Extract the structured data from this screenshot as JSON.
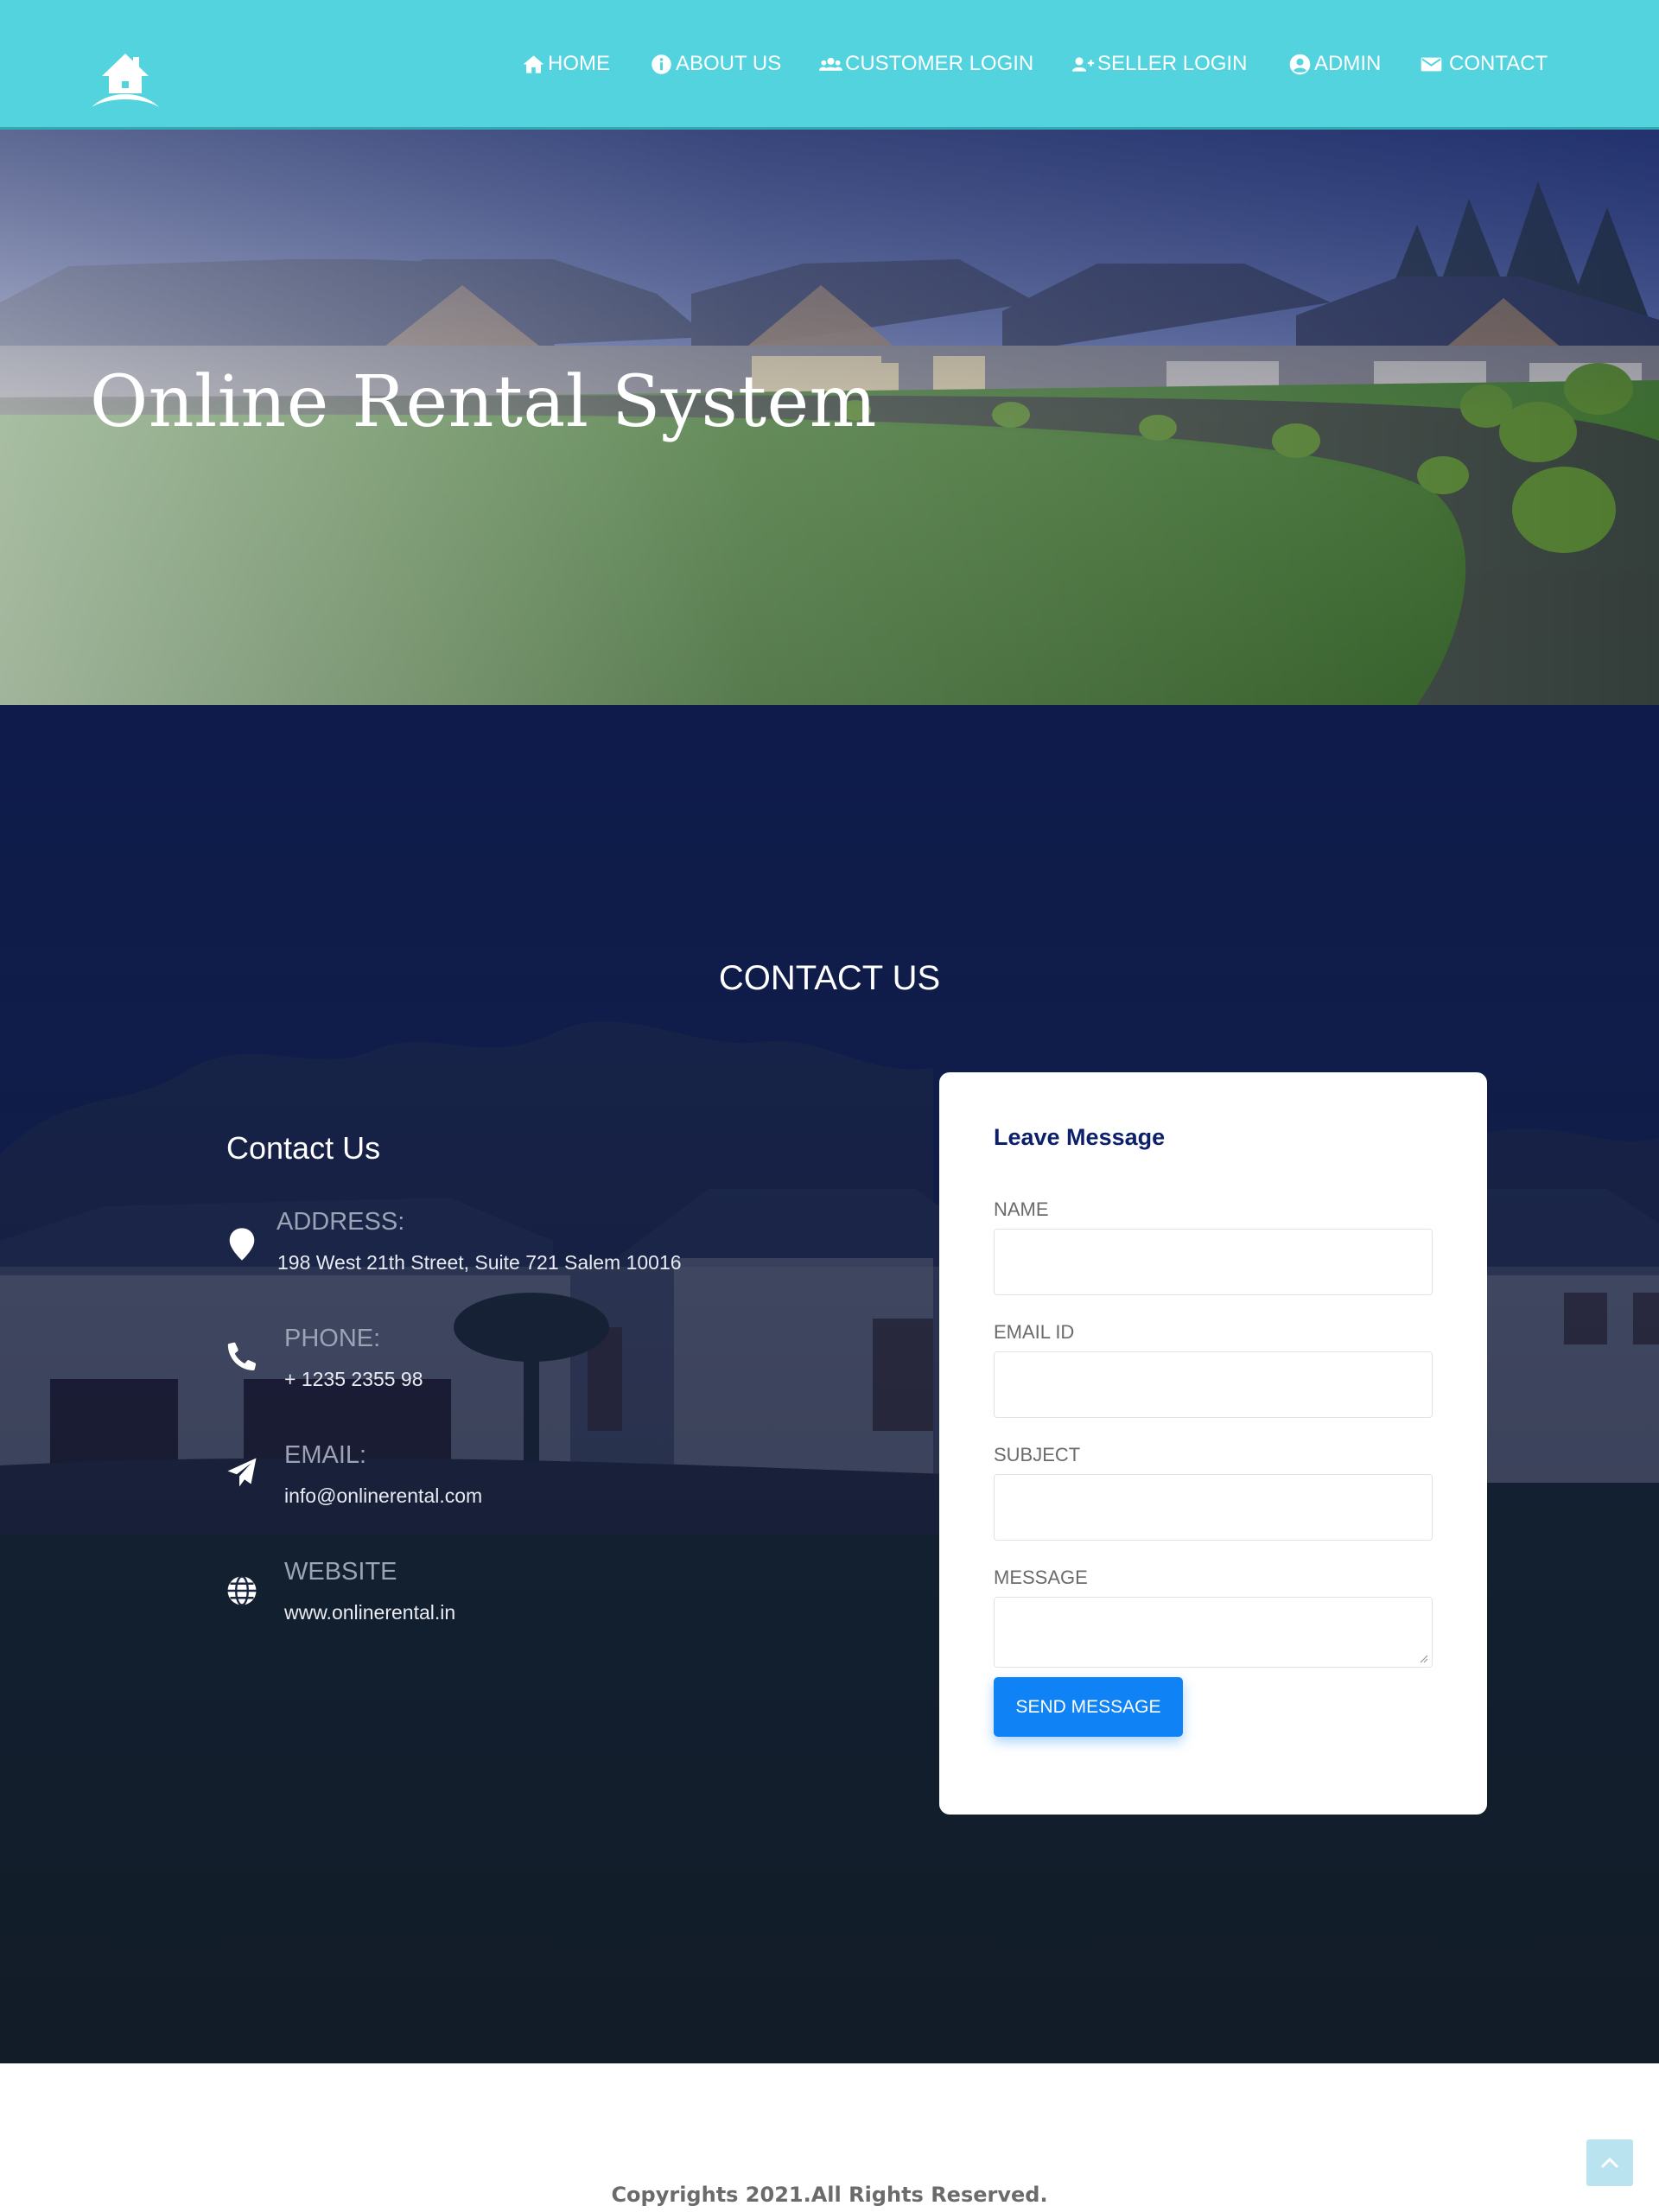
{
  "nav": {
    "items": [
      {
        "label": "HOME",
        "icon": "home-icon"
      },
      {
        "label": "ABOUT US",
        "icon": "info-circle-icon"
      },
      {
        "label": "CUSTOMER LOGIN",
        "icon": "users-icon"
      },
      {
        "label": "SELLER LOGIN",
        "icon": "user-plus-icon"
      },
      {
        "label": "ADMIN",
        "icon": "user-circle-icon"
      },
      {
        "label": "CONTACT",
        "icon": "envelope-icon"
      }
    ]
  },
  "hero": {
    "title": "Online Rental System"
  },
  "contact": {
    "section_title": "CONTACT US",
    "info_heading": "Contact Us",
    "items": [
      {
        "label": "ADDRESS:",
        "value": "198 West 21th Street, Suite 721 Salem 10016",
        "icon": "map-pin-icon"
      },
      {
        "label": "PHONE:",
        "value": "+ 1235 2355 98",
        "icon": "phone-icon"
      },
      {
        "label": "EMAIL:",
        "value": "info@onlinerental.com",
        "icon": "paper-plane-icon"
      },
      {
        "label": "WEBSITE",
        "value": "www.onlinerental.in",
        "icon": "globe-icon"
      }
    ]
  },
  "form": {
    "title": "Leave Message",
    "fields": {
      "name": {
        "label": "NAME",
        "value": ""
      },
      "email": {
        "label": "EMAIL ID",
        "value": ""
      },
      "subject": {
        "label": "SUBJECT",
        "value": ""
      },
      "message": {
        "label": "MESSAGE",
        "value": ""
      }
    },
    "submit_label": "SEND MESSAGE"
  },
  "footer": {
    "copyright": "Copyrights 2021.All Rights Reserved."
  },
  "colors": {
    "navbar": "#52d3de",
    "section_bg": "#0f1d4d",
    "accent_button": "#0f83f5",
    "form_title": "#0c1f6b"
  }
}
